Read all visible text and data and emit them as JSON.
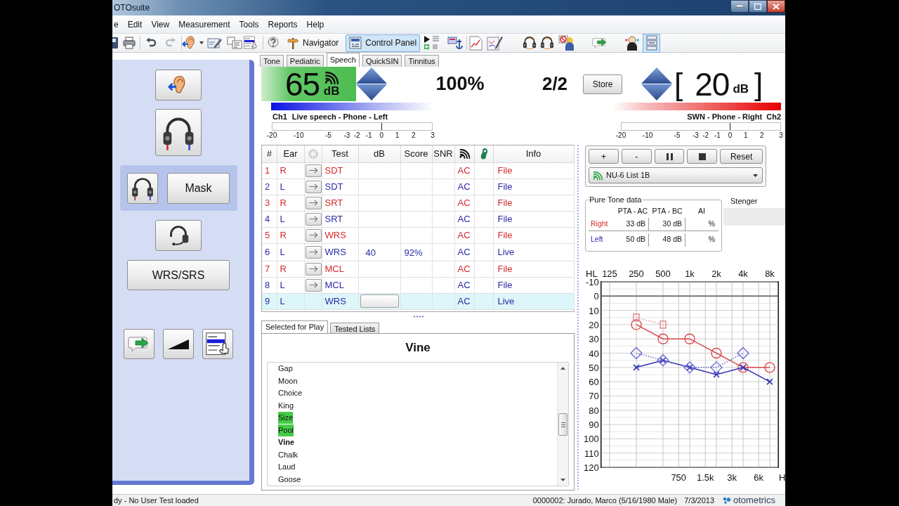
{
  "window": {
    "title": "OTOsuite"
  },
  "menu": [
    "e",
    "Edit",
    "View",
    "Measurement",
    "Tools",
    "Reports",
    "Help"
  ],
  "toolbar": {
    "buttons": [
      {
        "label": "Navigator",
        "selected": false
      },
      {
        "label": "Control Panel",
        "selected": true
      }
    ],
    "layout_toggle": {
      "selected": true
    }
  },
  "tabs": [
    {
      "label": "Tone",
      "selected": false
    },
    {
      "label": "Pediatric",
      "selected": false
    },
    {
      "label": "Speech",
      "selected": true
    },
    {
      "label": "QuickSIN",
      "selected": false
    },
    {
      "label": "Tinnitus",
      "selected": false
    }
  ],
  "left_panel": {
    "mask_button": {
      "label": "Mask",
      "on": true
    },
    "mode_button": {
      "label": "WRS/SRS"
    }
  },
  "channel_1": {
    "value": "65",
    "unit": "dB",
    "active": true,
    "label": "Ch1",
    "route": "Live speech - Phone - Left",
    "scale": [
      "-20",
      "-10",
      "-5",
      "-3",
      "-2",
      "-1",
      "0",
      "1",
      "2",
      "3"
    ]
  },
  "score": "100%",
  "count": "2/2",
  "store_button": {
    "label": "Store"
  },
  "channel_2": {
    "bracket_open": "[",
    "value": "20",
    "unit": "dB",
    "bracket_close": "]",
    "active": false,
    "label": "Ch2",
    "route": "SWN - Phone - Right",
    "scale": [
      "-20",
      "-10",
      "-5",
      "-3",
      "-2",
      "-1",
      "0",
      "1",
      "2",
      "3"
    ]
  },
  "table": {
    "columns": [
      "#",
      "Ear",
      "Test",
      "dB",
      "Score",
      "SNR",
      "Info"
    ],
    "rows": [
      {
        "num": "1",
        "ear": "R",
        "kind": "right",
        "test": "SDT",
        "transducer": "AC",
        "info": "File",
        "selected": false
      },
      {
        "num": "2",
        "ear": "L",
        "kind": "left",
        "test": "SDT",
        "transducer": "AC",
        "info": "File",
        "selected": false
      },
      {
        "num": "3",
        "ear": "R",
        "kind": "right",
        "test": "SRT",
        "transducer": "AC",
        "info": "File",
        "selected": false
      },
      {
        "num": "4",
        "ear": "L",
        "kind": "left",
        "test": "SRT",
        "transducer": "AC",
        "info": "File",
        "selected": false
      },
      {
        "num": "5",
        "ear": "R",
        "kind": "right",
        "test": "WRS",
        "transducer": "AC",
        "info": "File",
        "selected": false
      },
      {
        "num": "6",
        "ear": "L",
        "kind": "left",
        "test": "WRS",
        "db": "40",
        "score": "92%",
        "transducer": "AC",
        "info": "Live",
        "selected": false
      },
      {
        "num": "7",
        "ear": "R",
        "kind": "right",
        "test": "MCL",
        "transducer": "AC",
        "info": "File",
        "selected": false
      },
      {
        "num": "8",
        "ear": "L",
        "kind": "left",
        "test": "MCL",
        "transducer": "AC",
        "info": "File",
        "selected": false
      },
      {
        "num": "9",
        "ear": "L",
        "kind": "left",
        "test": "WRS",
        "transducer": "AC",
        "info": "Live",
        "selected": true
      }
    ]
  },
  "controls": {
    "buttons": [
      {
        "kind": "text",
        "label": "+"
      },
      {
        "kind": "text",
        "label": "-"
      },
      {
        "kind": "pause"
      },
      {
        "kind": "stop"
      },
      {
        "kind": "text",
        "label": "Reset"
      }
    ],
    "list_select": {
      "value": "NU-6 List 1B"
    }
  },
  "pure_tone": {
    "title": "Pure Tone data",
    "columns": [
      "PTA - AC",
      "PTA - BC",
      "AI"
    ],
    "rows": [
      {
        "label": "Right",
        "kind": "right",
        "values": [
          "33 dB",
          "30 dB",
          "%"
        ]
      },
      {
        "label": "Left",
        "kind": "left",
        "values": [
          "50 dB",
          "48 dB",
          "%"
        ]
      }
    ]
  },
  "stenger": {
    "title": "Stenger"
  },
  "audiogram": {
    "chart_data": {
      "type": "line",
      "ylabel": "HL",
      "xlabel": "H",
      "log": "x",
      "grid": true,
      "xlim": [
        100,
        10000
      ],
      "ylim": [
        120,
        -10
      ],
      "xticks": [
        {
          "value": 125,
          "label": "125"
        },
        {
          "value": 250,
          "label": "250"
        },
        {
          "value": 500,
          "label": "500"
        },
        {
          "value": 1000,
          "label": "1k"
        },
        {
          "value": 2000,
          "label": "2k"
        },
        {
          "value": 4000,
          "label": "4k"
        },
        {
          "value": 8000,
          "label": "8k"
        }
      ],
      "annotations": [
        "750",
        "1.5k",
        "3k",
        "6k"
      ],
      "yticks": [
        -10,
        0,
        10,
        20,
        30,
        40,
        50,
        60,
        70,
        80,
        90,
        100,
        110,
        120
      ],
      "ref_lines": [
        {
          "axis": "y",
          "value": 0,
          "color": "#555555"
        }
      ],
      "series": [
        {
          "color": "#d9484c",
          "marker": "circle",
          "line_style": "solid",
          "x": [
            250,
            500,
            1000,
            2000,
            4000,
            8000
          ],
          "values": [
            20,
            30,
            30,
            40,
            50,
            50
          ]
        },
        {
          "color": "#2f2fb4",
          "marker": "cross",
          "line_style": "solid",
          "x": [
            250,
            500,
            1000,
            2000,
            4000,
            8000
          ],
          "values": [
            50,
            45,
            50,
            55,
            50,
            60
          ]
        },
        {
          "color": "#e58c94",
          "marker": "square",
          "line_style": "dotted",
          "x": [
            250,
            500
          ],
          "values": [
            15,
            20
          ]
        },
        {
          "color": "#6464d6",
          "marker": "diamond",
          "line_style": "dotted",
          "x": [
            250,
            500,
            1000,
            2000,
            4000
          ],
          "values": [
            40,
            45,
            50,
            50,
            40
          ]
        }
      ]
    }
  },
  "word_list": {
    "tabs": [
      {
        "label": "Selected for Play",
        "selected": true
      },
      {
        "label": "Tested Lists",
        "selected": false
      }
    ],
    "current_word": "Vine",
    "words": [
      {
        "text": "Gap",
        "marked": false,
        "current": false
      },
      {
        "text": "Moon",
        "marked": false,
        "current": false
      },
      {
        "text": "Choice",
        "marked": false,
        "current": false
      },
      {
        "text": "King",
        "marked": false,
        "current": false
      },
      {
        "text": "Size",
        "marked": true,
        "current": false
      },
      {
        "text": "Pool",
        "marked": true,
        "current": false
      },
      {
        "text": "Vine",
        "marked": false,
        "current": true
      },
      {
        "text": "Chalk",
        "marked": false,
        "current": false
      },
      {
        "text": "Laud",
        "marked": false,
        "current": false
      },
      {
        "text": "Goose",
        "marked": false,
        "current": false
      }
    ]
  },
  "status_bar": {
    "message": "dy - No User Test loaded",
    "patient": "0000002: Jurado, Marco (5/16/1980 Male)",
    "date": "7/3/2013",
    "brand": "otometrics"
  }
}
